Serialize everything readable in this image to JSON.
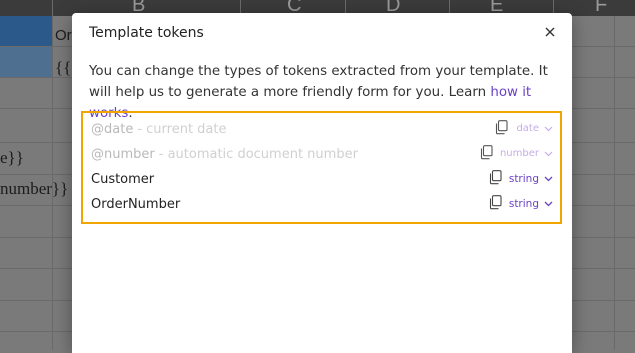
{
  "spreadsheet": {
    "column_letters": [
      "A",
      "B",
      "C",
      "D",
      "E",
      "F"
    ],
    "cells": {
      "b1_partial": "Or",
      "b2_partial": "{{C",
      "a5_partial": "e}}",
      "a6_partial": "number}}"
    }
  },
  "dialog": {
    "title": "Template tokens",
    "description": "You can change the types of tokens extracted from your template. It will help us to generate a more friendly form for you. Learn ",
    "link_text": "how it works",
    "after_link": ".",
    "tokens": [
      {
        "name": "@date",
        "desc": "- current date",
        "type": "date",
        "enabled": false,
        "copy_icon": "copy-icon"
      },
      {
        "name": "@number",
        "desc": "- automatic document number",
        "type": "number",
        "enabled": false,
        "copy_icon": "copy-icon"
      },
      {
        "name": "Customer",
        "desc": "",
        "type": "string",
        "enabled": true,
        "copy_icon": "copy-icon"
      },
      {
        "name": "OrderNumber",
        "desc": "",
        "type": "string",
        "enabled": true,
        "copy_icon": "copy-icon"
      }
    ]
  },
  "colors": {
    "accent": "#6a42c7",
    "highlight_border": "#f0a500",
    "selected_cell": "#2b5a8a"
  }
}
